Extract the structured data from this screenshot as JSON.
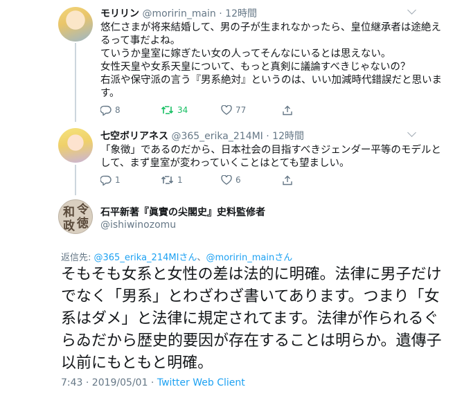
{
  "tweets": [
    {
      "name": "モリリン",
      "handle": "@moririn_main",
      "sep": "·",
      "time": "12時間",
      "lines": [
        "悠仁さまが将来結婚して、男の子が生まれなかったら、皇位継承者は途絶え",
        "るって事だよね。",
        "ていうか皇室に嫁ぎたい女の人ってそんなにいるとは思えない。",
        "女性天皇や女系天皇について、もっと真剣に議論すべきじゃないの？",
        "右派や保守派の言う『男系絶対』というのは、いい加減時代錯誤だと思いま",
        "す。"
      ],
      "replies": "8",
      "retweets": "34",
      "likes": "77"
    },
    {
      "name": "七空ボリアネス",
      "handle": "@365_erika_214MI",
      "sep": "·",
      "time": "12時間",
      "lines": [
        "「象徴」であるのだから、日本社会の目指すべきジェンダー平等のモデルと",
        "して、まず皇室が変わっていくことはとても望ましい。"
      ],
      "replies": "1",
      "retweets": "1",
      "likes": "6"
    }
  ],
  "main_tweet": {
    "name": "石平新著『眞實の尖閣史』史料監修者",
    "handle": "@ishiwinozomu",
    "avatar_chars": [
      "令",
      "和",
      "徳",
      "政"
    ],
    "replying_label": "返信先: ",
    "reply_to_1": "@365_erika_214MIさん",
    "reply_sep": "、",
    "reply_to_2": "@moririn_mainさん",
    "lines": [
      "そもそも女系と女性の差は法的に明確。法律に男子だけ",
      "でなく「男系」とわざわざ書いてあります。つまり「女",
      "系はダメ」と法律に規定されてます。法律が作られるぐ",
      "らゐだから歴史的要因が存在することは明らか。遺傳子",
      "以前にもともと明確。"
    ],
    "timestamp": "7:43 · 2019/05/01 · ",
    "client": "Twitter Web Client"
  },
  "colors": {
    "link": "#1da1f2",
    "secondary_text": "#657786",
    "retweet_active": "#17bf63",
    "divider": "#e6ecf0"
  },
  "icons": [
    "reply-icon",
    "retweet-icon",
    "like-icon",
    "share-icon",
    "chevron-down-icon"
  ]
}
